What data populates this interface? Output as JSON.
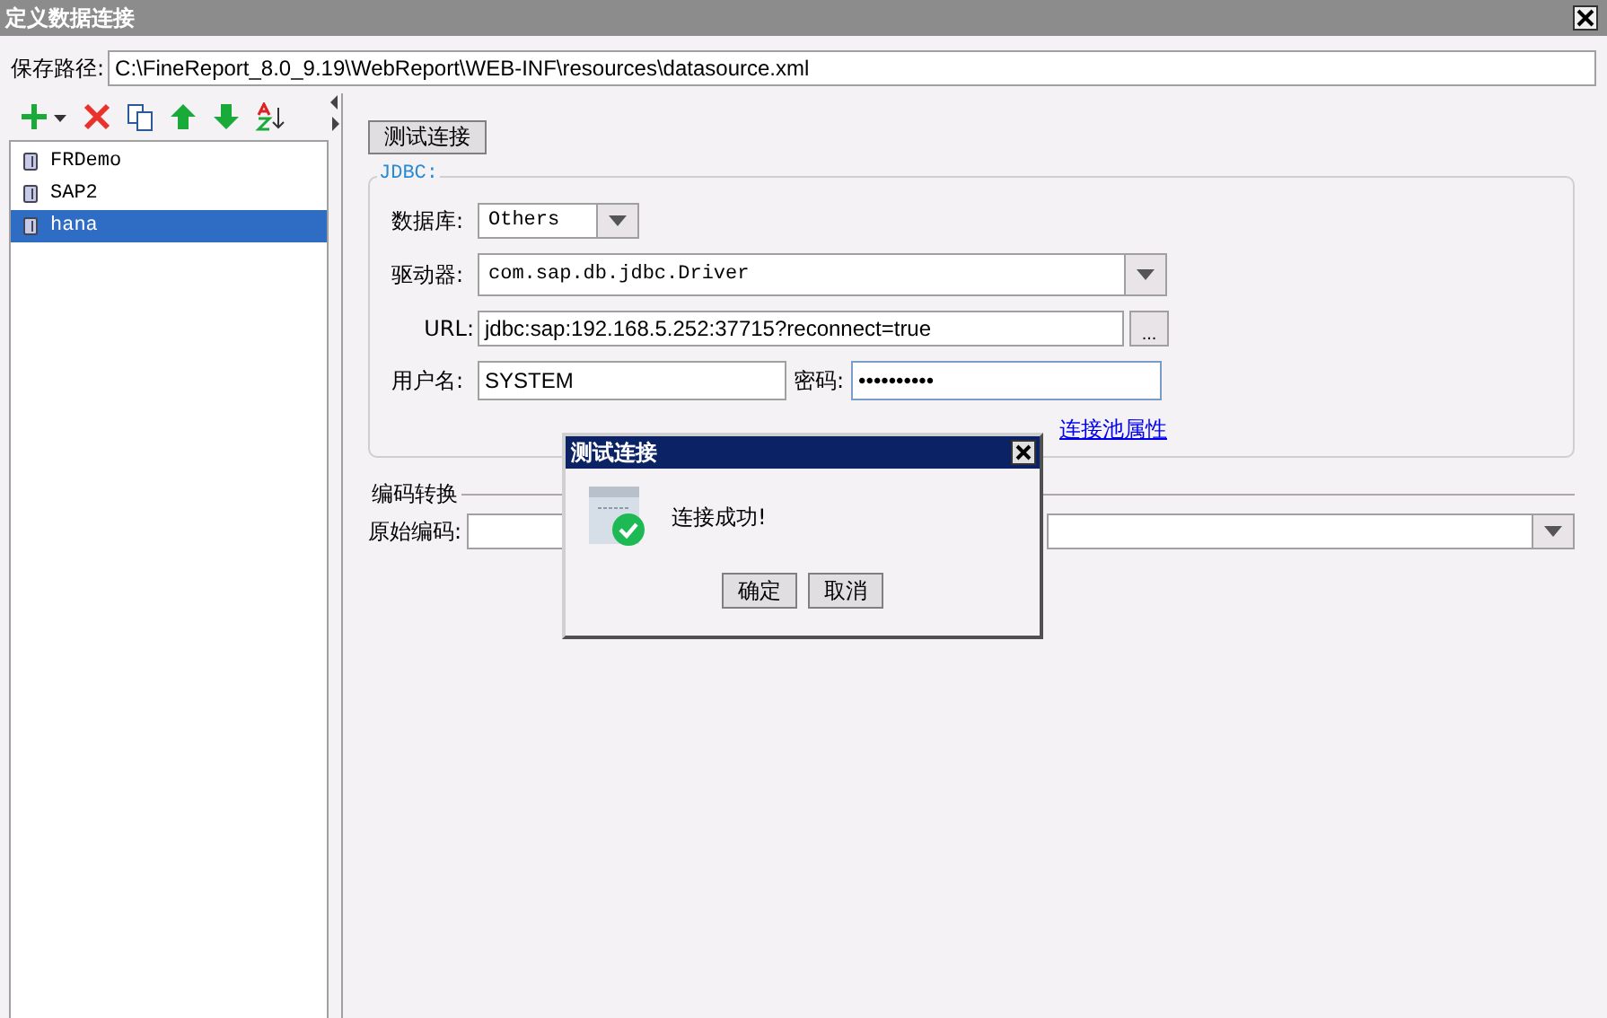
{
  "window": {
    "title": "定义数据连接"
  },
  "path": {
    "label": "保存路径:",
    "value": "C:\\FineReport_8.0_9.19\\WebReport\\WEB-INF\\resources\\datasource.xml"
  },
  "connections": [
    {
      "name": "FRDemo",
      "selected": false
    },
    {
      "name": "SAP2",
      "selected": false
    },
    {
      "name": "hana",
      "selected": true
    }
  ],
  "test_button": "测试连接",
  "jdbc": {
    "legend": "JDBC:",
    "database": {
      "label": "数据库:",
      "value": "Others"
    },
    "driver": {
      "label": "驱动器:",
      "value": "com.sap.db.jdbc.Driver"
    },
    "url": {
      "label": "URL:",
      "value": "jdbc:sap:192.168.5.252:37715?reconnect=true",
      "button": "..."
    },
    "username": {
      "label": "用户名:",
      "value": "SYSTEM"
    },
    "password": {
      "label": "密码:",
      "value": "••••••••••",
      "focused": true
    },
    "pool_link": "连接池属性"
  },
  "encoding": {
    "legend": "编码转换",
    "label": "原始编码:"
  },
  "dialog": {
    "title": "测试连接",
    "message": "连接成功!",
    "buttons": [
      "确定",
      "取消"
    ]
  }
}
